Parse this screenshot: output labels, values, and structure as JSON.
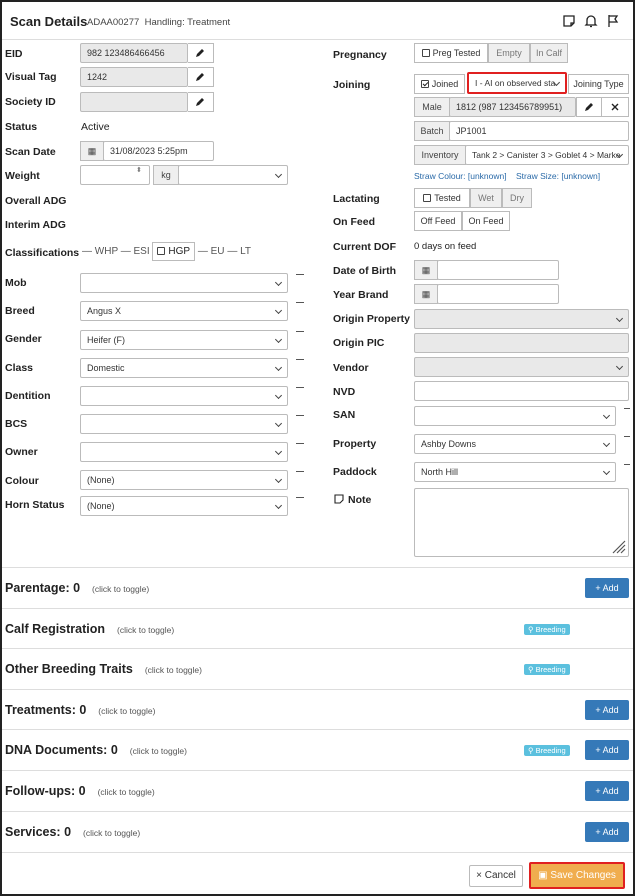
{
  "header": {
    "title": "Scan Details",
    "animal_id": "ADAA00277",
    "handling": "Handling: Treatment"
  },
  "left": {
    "eid": {
      "label": "EID",
      "value": "982 123486466456"
    },
    "visual_tag": {
      "label": "Visual Tag",
      "value": "1242"
    },
    "society_id": {
      "label": "Society ID",
      "value": ""
    },
    "status": {
      "label": "Status",
      "value": "Active"
    },
    "scan_date": {
      "label": "Scan Date",
      "value": "31/08/2023 5:25pm"
    },
    "weight": {
      "label": "Weight",
      "unit": "kg",
      "value": ""
    },
    "overall_adg": {
      "label": "Overall ADG"
    },
    "interim_adg": {
      "label": "Interim ADG"
    },
    "classifications": {
      "label": "Classifications",
      "items": [
        "WHP",
        "ESI",
        "HGP",
        "EU",
        "LT"
      ]
    },
    "mob": {
      "label": "Mob",
      "value": ""
    },
    "breed": {
      "label": "Breed",
      "value": "Angus X"
    },
    "gender": {
      "label": "Gender",
      "value": "Heifer (F)"
    },
    "class": {
      "label": "Class",
      "value": "Domestic"
    },
    "dentition": {
      "label": "Dentition",
      "value": ""
    },
    "bcs": {
      "label": "BCS",
      "value": ""
    },
    "owner": {
      "label": "Owner",
      "value": ""
    },
    "colour": {
      "label": "Colour",
      "value": "(None)"
    },
    "horn_status": {
      "label": "Horn Status",
      "value": "(None)"
    }
  },
  "right": {
    "pregnancy": {
      "label": "Pregnancy",
      "options": [
        "Preg Tested",
        "Empty",
        "In Calf"
      ]
    },
    "joining": {
      "label": "Joining",
      "joined": "Joined",
      "method": "I - AI on observed sta",
      "type_button": "Joining Type"
    },
    "male": {
      "addon": "Male",
      "value": "1812 (987 123456789951)"
    },
    "batch": {
      "addon": "Batch",
      "value": "JP1001"
    },
    "inventory": {
      "addon": "Inventory",
      "value": "Tank 2 > Canister 3 > Goblet 4 > Marke"
    },
    "straw_colour": "Straw Colour: [unknown]",
    "straw_size": "Straw Size: [unknown]",
    "lactating": {
      "label": "Lactating",
      "options": [
        "Tested",
        "Wet",
        "Dry"
      ]
    },
    "on_feed": {
      "label": "On Feed",
      "options": [
        "Off Feed",
        "On Feed"
      ]
    },
    "current_dof": {
      "label": "Current DOF",
      "value": "0 days on feed"
    },
    "date_of_birth": {
      "label": "Date of Birth",
      "value": ""
    },
    "year_brand": {
      "label": "Year Brand",
      "value": ""
    },
    "origin_property": {
      "label": "Origin Property",
      "value": ""
    },
    "origin_pic": {
      "label": "Origin PIC",
      "value": ""
    },
    "vendor": {
      "label": "Vendor",
      "value": ""
    },
    "nvd": {
      "label": "NVD",
      "value": ""
    },
    "san": {
      "label": "SAN",
      "value": ""
    },
    "property": {
      "label": "Property",
      "value": "Ashby Downs"
    },
    "paddock": {
      "label": "Paddock",
      "value": "North Hill"
    },
    "note": {
      "label": "Note",
      "value": ""
    }
  },
  "sections": [
    {
      "title": "Parentage:",
      "count": "0",
      "toggle": "(click to toggle)",
      "add": "+ Add"
    },
    {
      "title": "Calf Registration",
      "toggle": "(click to toggle)",
      "badge": "Breeding"
    },
    {
      "title": "Other Breeding Traits",
      "toggle": "(click to toggle)",
      "badge": "Breeding"
    },
    {
      "title": "Treatments:",
      "count": "0",
      "toggle": "(click to toggle)",
      "add": "+ Add"
    },
    {
      "title": "DNA Documents:",
      "count": "0",
      "toggle": "(click to toggle)",
      "badge": "Breeding",
      "add": "+ Add"
    },
    {
      "title": "Follow-ups:",
      "count": "0",
      "toggle": "(click to toggle)",
      "add": "+ Add"
    },
    {
      "title": "Services:",
      "count": "0",
      "toggle": "(click to toggle)",
      "add": "+ Add"
    }
  ],
  "footer": {
    "cancel": "× Cancel",
    "save": "Save Changes"
  },
  "colors": {
    "primary": "#3579b8",
    "breeding_badge": "#5bc0de",
    "save": "#f0ad4e",
    "highlight": "#e02020"
  }
}
